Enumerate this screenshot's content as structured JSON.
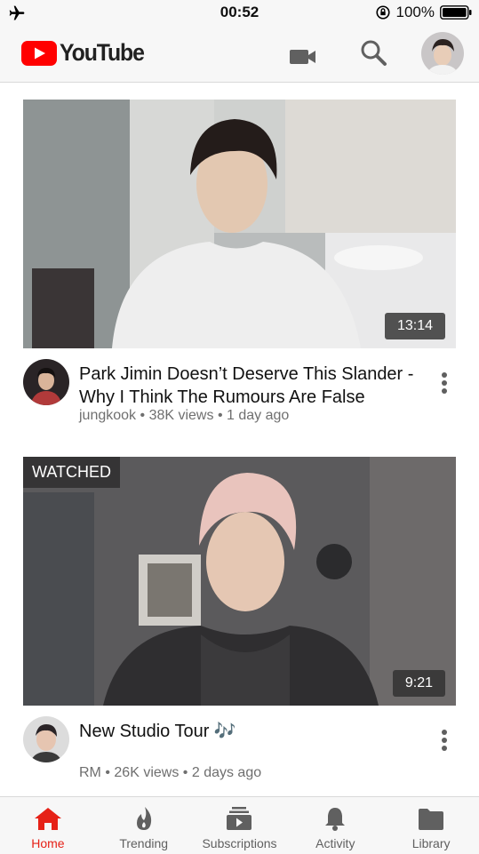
{
  "status_bar": {
    "time": "00:52",
    "battery": "100%"
  },
  "app": {
    "name": "YouTube",
    "brand_color": "#ff0000"
  },
  "videos": [
    {
      "title": "Park Jimin Doesn’t Deserve This Slander - Why I Think The Rumours Are False",
      "channel": "jungkook",
      "views": "38K views",
      "age": "1 day ago",
      "duration": "13:14",
      "watched_label": ""
    },
    {
      "title": "New Studio Tour 🎶",
      "channel": "RM",
      "views": "26K views",
      "age": "2 days ago",
      "duration": "9:21",
      "watched_label": "WATCHED"
    }
  ],
  "meta_separator": "•",
  "nav": [
    {
      "label": "Home",
      "icon": "home-icon",
      "active": true
    },
    {
      "label": "Trending",
      "icon": "trending-icon",
      "active": false
    },
    {
      "label": "Subscriptions",
      "icon": "subscriptions-icon",
      "active": false
    },
    {
      "label": "Activity",
      "icon": "bell-icon",
      "active": false
    },
    {
      "label": "Library",
      "icon": "library-icon",
      "active": false
    }
  ]
}
